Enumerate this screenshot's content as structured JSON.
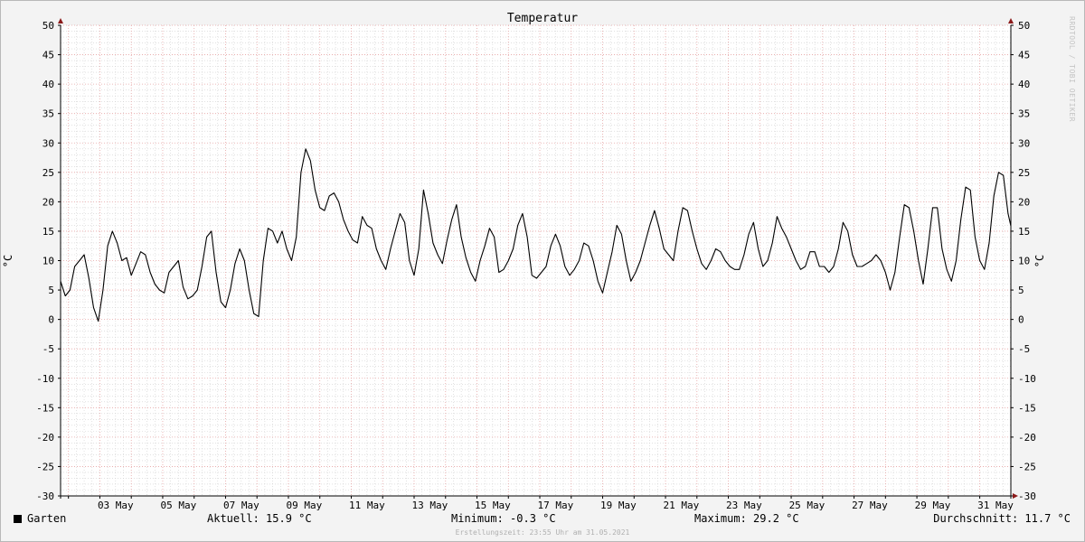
{
  "chart_data": {
    "type": "line",
    "title": "Temperatur",
    "ylabel": "°C",
    "ylabel_right": "°C",
    "ylim": [
      -30,
      50
    ],
    "yticks": [
      50,
      45,
      40,
      35,
      30,
      25,
      20,
      15,
      10,
      5,
      0,
      -5,
      -10,
      -15,
      -20,
      -25,
      -30
    ],
    "xlim": [
      1.75,
      31.99
    ],
    "xticks": [
      {
        "day": 3,
        "label": "03 May"
      },
      {
        "day": 5,
        "label": "05 May"
      },
      {
        "day": 7,
        "label": "07 May"
      },
      {
        "day": 9,
        "label": "09 May"
      },
      {
        "day": 11,
        "label": "11 May"
      },
      {
        "day": 13,
        "label": "13 May"
      },
      {
        "day": 15,
        "label": "15 May"
      },
      {
        "day": 17,
        "label": "17 May"
      },
      {
        "day": 19,
        "label": "19 May"
      },
      {
        "day": 21,
        "label": "21 May"
      },
      {
        "day": 23,
        "label": "23 May"
      },
      {
        "day": 25,
        "label": "25 May"
      },
      {
        "day": 27,
        "label": "27 May"
      },
      {
        "day": 29,
        "label": "29 May"
      },
      {
        "day": 31,
        "label": "31 May"
      }
    ],
    "grid": true,
    "series": [
      {
        "name": "Garten",
        "color": "#000000",
        "x": [
          1.75,
          1.9,
          2.05,
          2.2,
          2.35,
          2.5,
          2.65,
          2.8,
          2.95,
          3.1,
          3.25,
          3.4,
          3.55,
          3.7,
          3.85,
          4.0,
          4.15,
          4.3,
          4.45,
          4.6,
          4.75,
          4.9,
          5.05,
          5.2,
          5.35,
          5.5,
          5.65,
          5.8,
          5.95,
          6.1,
          6.25,
          6.4,
          6.55,
          6.7,
          6.85,
          7.0,
          7.15,
          7.3,
          7.45,
          7.6,
          7.75,
          7.9,
          8.05,
          8.2,
          8.35,
          8.5,
          8.65,
          8.8,
          8.95,
          9.1,
          9.25,
          9.4,
          9.55,
          9.7,
          9.85,
          10.0,
          10.15,
          10.3,
          10.45,
          10.6,
          10.75,
          10.9,
          11.05,
          11.2,
          11.35,
          11.5,
          11.65,
          11.8,
          11.95,
          12.1,
          12.25,
          12.4,
          12.55,
          12.7,
          12.85,
          13.0,
          13.15,
          13.3,
          13.45,
          13.6,
          13.75,
          13.9,
          14.05,
          14.2,
          14.35,
          14.5,
          14.65,
          14.8,
          14.95,
          15.1,
          15.25,
          15.4,
          15.55,
          15.7,
          15.85,
          16.0,
          16.15,
          16.3,
          16.45,
          16.6,
          16.75,
          16.9,
          17.05,
          17.2,
          17.35,
          17.5,
          17.65,
          17.8,
          17.95,
          18.1,
          18.25,
          18.4,
          18.55,
          18.7,
          18.85,
          19.0,
          19.15,
          19.3,
          19.45,
          19.6,
          19.75,
          19.9,
          20.05,
          20.2,
          20.35,
          20.5,
          20.65,
          20.8,
          20.95,
          21.1,
          21.25,
          21.4,
          21.55,
          21.7,
          21.85,
          22.0,
          22.15,
          22.3,
          22.45,
          22.6,
          22.75,
          22.9,
          23.05,
          23.2,
          23.35,
          23.5,
          23.65,
          23.8,
          23.95,
          24.1,
          24.25,
          24.4,
          24.55,
          24.7,
          24.85,
          25.0,
          25.15,
          25.3,
          25.45,
          25.6,
          25.75,
          25.9,
          26.05,
          26.2,
          26.35,
          26.5,
          26.65,
          26.8,
          26.95,
          27.1,
          27.25,
          27.4,
          27.55,
          27.7,
          27.85,
          28.0,
          28.15,
          28.3,
          28.45,
          28.6,
          28.75,
          28.9,
          29.05,
          29.2,
          29.35,
          29.5,
          29.65,
          29.8,
          29.95,
          30.1,
          30.25,
          30.4,
          30.55,
          30.7,
          30.85,
          31.0,
          31.15,
          31.3,
          31.45,
          31.6,
          31.75,
          31.9,
          31.99
        ],
        "values": [
          6.5,
          4.0,
          5.0,
          9.0,
          10.0,
          11.0,
          7.0,
          2.0,
          -0.3,
          5.0,
          12.5,
          15.0,
          13.0,
          10.0,
          10.5,
          7.5,
          9.5,
          11.5,
          11.0,
          8.0,
          6.0,
          5.0,
          4.5,
          8.0,
          9.0,
          10.0,
          5.5,
          3.5,
          4.0,
          5.0,
          9.0,
          14.0,
          15.0,
          8.0,
          3.0,
          2.0,
          5.0,
          9.5,
          12.0,
          10.0,
          5.0,
          1.0,
          0.5,
          10.0,
          15.5,
          15.0,
          13.0,
          15.0,
          12.0,
          10.0,
          14.0,
          25.0,
          29.0,
          27.0,
          22.0,
          19.0,
          18.5,
          21.0,
          21.5,
          20.0,
          17.0,
          15.0,
          13.5,
          13.0,
          17.5,
          16.0,
          15.5,
          12.0,
          10.0,
          8.5,
          12.0,
          15.0,
          18.0,
          16.5,
          10.0,
          7.5,
          12.0,
          22.0,
          18.0,
          13.0,
          11.0,
          9.5,
          13.5,
          17.0,
          19.5,
          14.0,
          10.5,
          8.0,
          6.5,
          10.0,
          12.5,
          15.5,
          14.0,
          8.0,
          8.5,
          10.0,
          12.0,
          16.0,
          18.0,
          14.0,
          7.5,
          7.0,
          8.0,
          9.0,
          12.5,
          14.5,
          12.5,
          9.0,
          7.5,
          8.5,
          10.0,
          13.0,
          12.5,
          10.0,
          6.5,
          4.5,
          8.0,
          11.5,
          16.0,
          14.5,
          10.0,
          6.5,
          8.0,
          10.0,
          13.0,
          16.0,
          18.5,
          15.5,
          12.0,
          11.0,
          10.0,
          15.0,
          19.0,
          18.5,
          15.0,
          12.0,
          9.5,
          8.5,
          10.0,
          12.0,
          11.5,
          10.0,
          9.0,
          8.5,
          8.5,
          11.0,
          14.5,
          16.5,
          12.0,
          9.0,
          10.0,
          13.0,
          17.5,
          15.5,
          14.0,
          12.0,
          10.0,
          8.5,
          9.0,
          11.5,
          11.5,
          9.0,
          9.0,
          8.0,
          9.0,
          12.0,
          16.5,
          15.0,
          11.0,
          9.0,
          9.0,
          9.5,
          10.0,
          11.0,
          10.0,
          8.0,
          5.0,
          8.0,
          14.0,
          19.5,
          19.0,
          15.0,
          10.0,
          6.0,
          12.0,
          19.0,
          19.0,
          12.0,
          8.5,
          6.5,
          10.0,
          17.0,
          22.5,
          22.0,
          14.0,
          10.0,
          8.5,
          13.0,
          21.0,
          25.0,
          24.5,
          18.0,
          15.9
        ]
      }
    ]
  },
  "legend": {
    "series_name": "Garten",
    "current": "Aktuell: 15.9 °C",
    "minimum": "Minimum: -0.3 °C",
    "maximum": "Maximum: 29.2 °C",
    "average": "Durchschnitt: 11.7 °C"
  },
  "footer": "Erstellungszeit: 23:55 Uhr am 31.05.2021",
  "watermark": "RRDTOOL / TOBI OETIKER",
  "colors": {
    "major_grid": "#e6a3a3",
    "minor_grid": "#cfcfcf",
    "axis": "#000000",
    "arrow": "#8b1a1a",
    "plot_bg": "#ffffff",
    "line": "#000000"
  }
}
